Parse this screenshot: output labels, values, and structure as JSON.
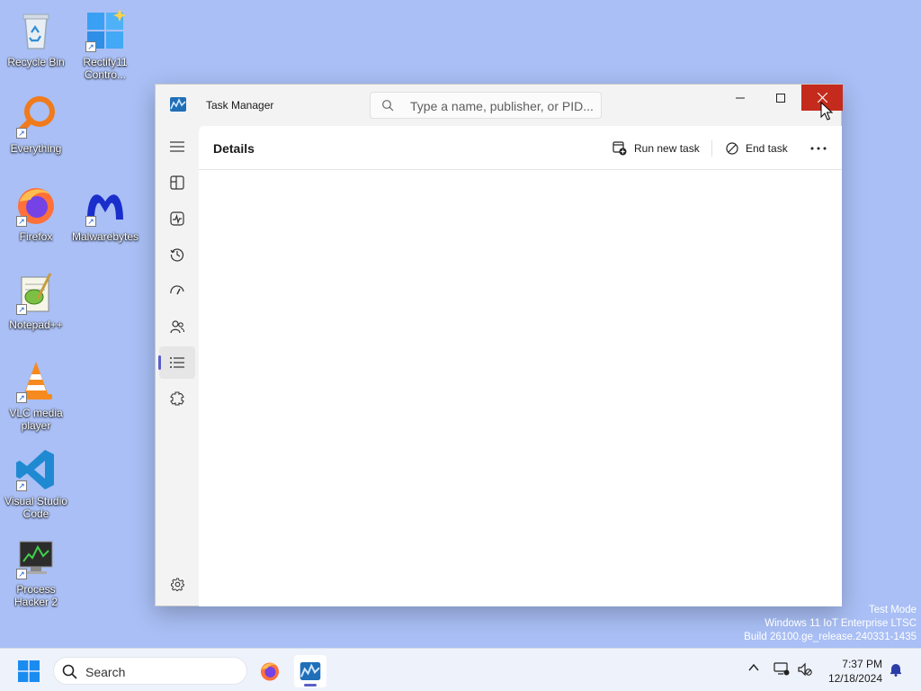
{
  "desktop": {
    "icons": [
      {
        "label": "Recycle Bin",
        "icon": "recycle-bin-icon"
      },
      {
        "label": "Rectify11 Contro...",
        "icon": "control-panel-icon"
      },
      {
        "label": "Everything",
        "icon": "everything-search-icon"
      },
      {
        "label": "Firefox",
        "icon": "firefox-icon"
      },
      {
        "label": "Malwarebytes",
        "icon": "malwarebytes-icon"
      },
      {
        "label": "Notepad++",
        "icon": "notepadpp-icon"
      },
      {
        "label": "VLC media player",
        "icon": "vlc-icon"
      },
      {
        "label": "Visual Studio Code",
        "icon": "vscode-icon"
      },
      {
        "label": "Process Hacker 2",
        "icon": "process-hacker-icon"
      }
    ]
  },
  "task_manager": {
    "title": "Task Manager",
    "search_placeholder": "Type a name, publisher, or PID...",
    "page_title": "Details",
    "commands": {
      "run_new_task": "Run new task",
      "end_task": "End task"
    },
    "nav": [
      {
        "name": "menu",
        "icon": "hamburger-icon"
      },
      {
        "name": "processes",
        "icon": "processes-icon"
      },
      {
        "name": "performance",
        "icon": "performance-icon"
      },
      {
        "name": "app-history",
        "icon": "history-icon"
      },
      {
        "name": "startup-apps",
        "icon": "startup-icon"
      },
      {
        "name": "users",
        "icon": "users-icon"
      },
      {
        "name": "details",
        "icon": "details-list-icon",
        "active": true
      },
      {
        "name": "services",
        "icon": "services-icon"
      },
      {
        "name": "settings",
        "icon": "gear-icon"
      }
    ],
    "accent": "#5b5fc7",
    "close_color": "#c42b1c"
  },
  "watermark": {
    "line1": "Test Mode",
    "line2": "Windows 11 IoT Enterprise LTSC",
    "line3": "Build 26100.ge_release.240331-1435"
  },
  "taskbar": {
    "search_label": "Search",
    "time": "7:37 PM",
    "date": "12/18/2024"
  }
}
